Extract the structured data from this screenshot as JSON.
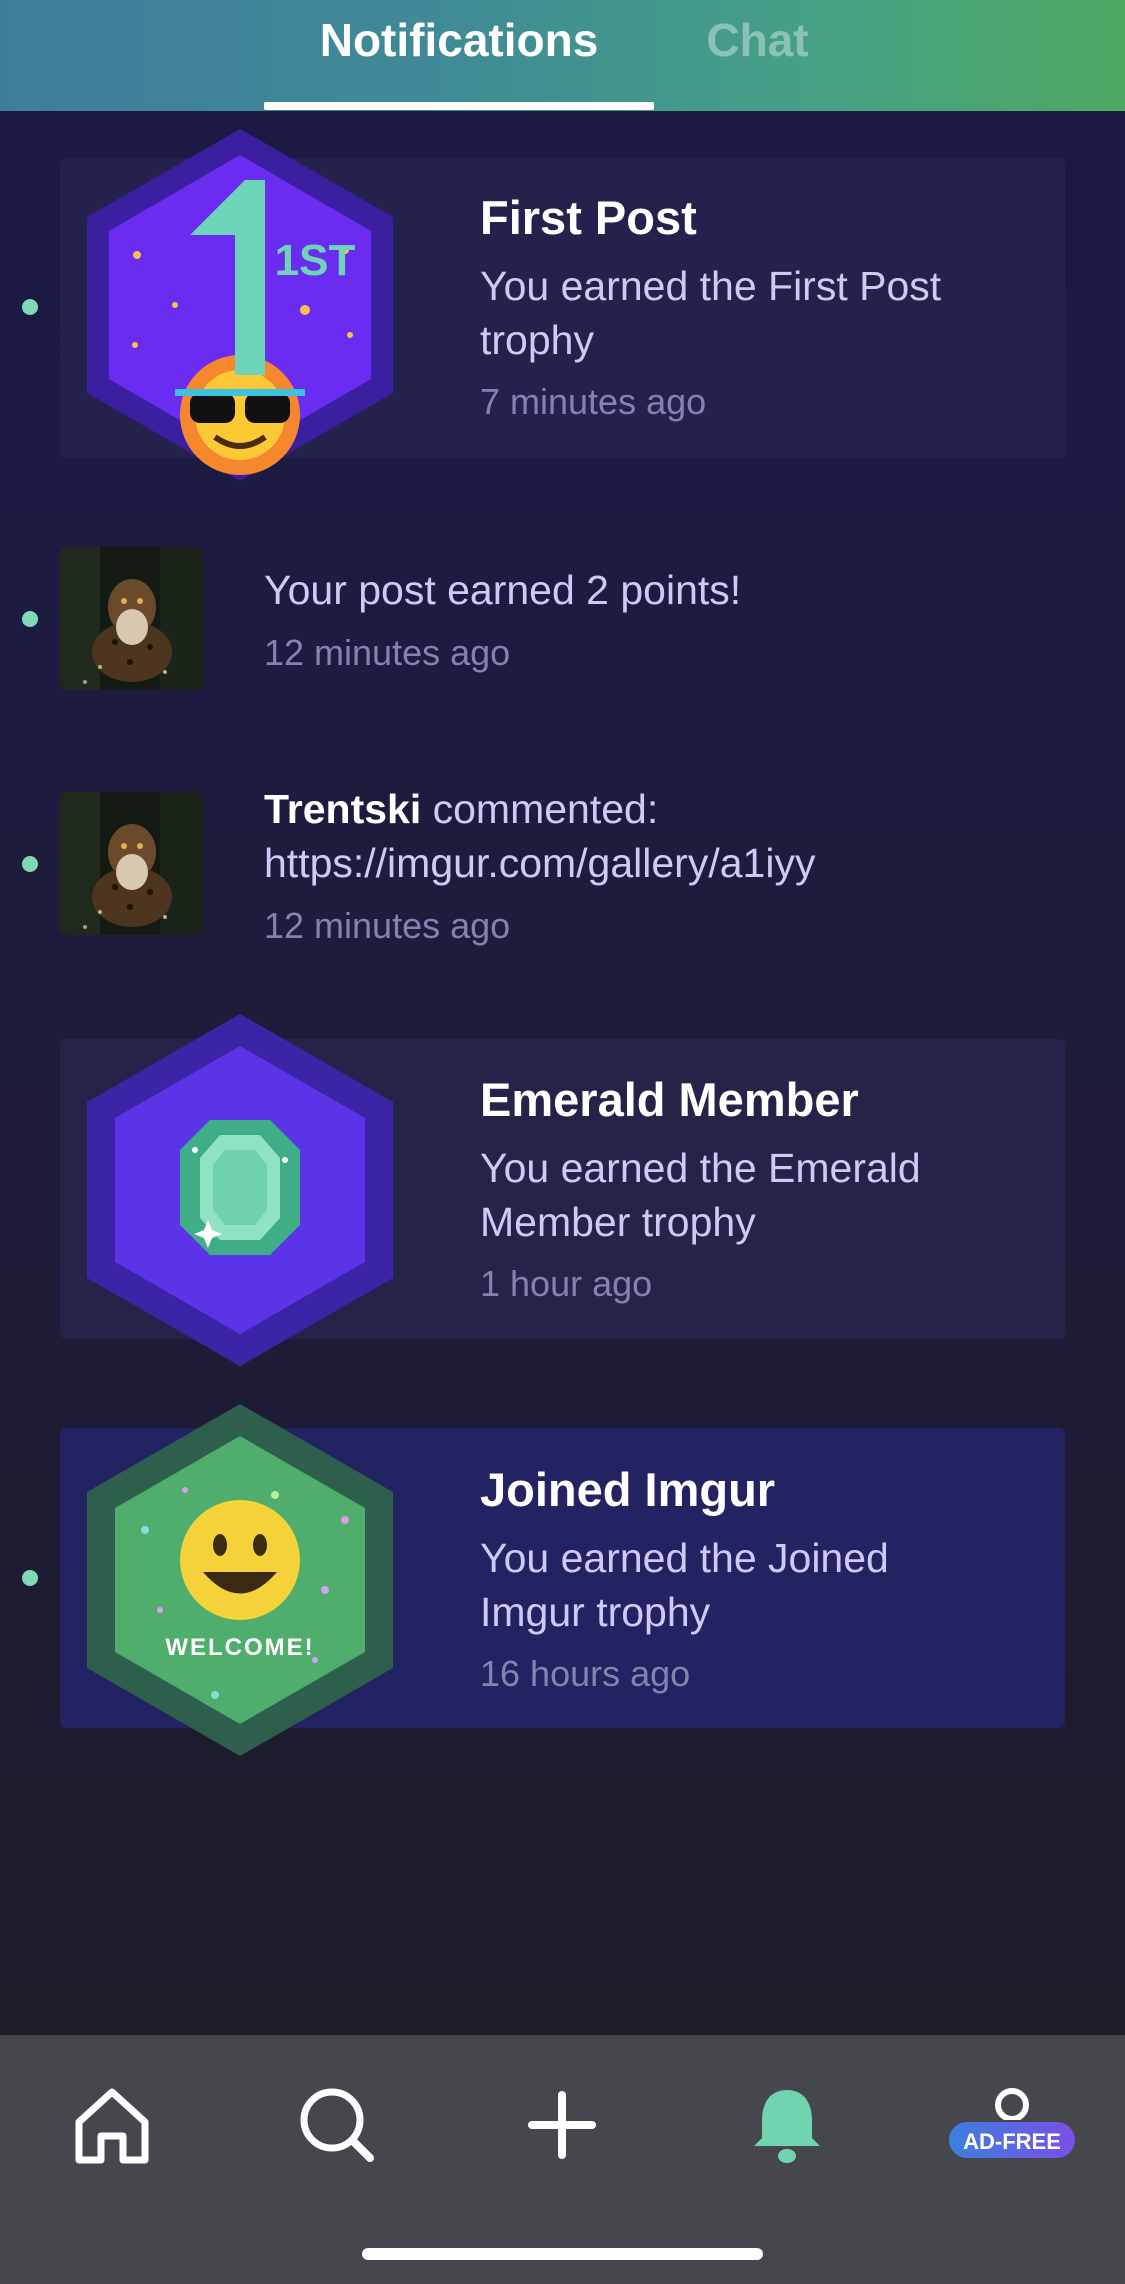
{
  "tabs": {
    "notifications": "Notifications",
    "chat": "Chat"
  },
  "notifications": [
    {
      "type": "trophy",
      "title": "First Post",
      "description": "You earned the First Post trophy",
      "time": "7 minutes ago",
      "unread": true,
      "badge": "first-post-badge",
      "badge_text": "1ST"
    },
    {
      "type": "post",
      "text": "Your post earned 2 points!",
      "time": "12 minutes ago",
      "unread": true,
      "thumbnail": "leopard-thumbnail"
    },
    {
      "type": "comment",
      "user": "Trentski",
      "text": " commented: https://imgur.com/gallery/a1iyy",
      "time": "12 minutes ago",
      "unread": true,
      "thumbnail": "leopard-thumbnail"
    },
    {
      "type": "trophy",
      "title": "Emerald Member",
      "description": "You earned the Emerald Member trophy",
      "time": "1 hour ago",
      "unread": false,
      "badge": "emerald-badge"
    },
    {
      "type": "trophy",
      "title": "Joined Imgur",
      "description": "You earned the Joined Imgur trophy",
      "time": "16 hours ago",
      "unread": true,
      "badge": "welcome-badge",
      "badge_text": "WELCOME!"
    }
  ],
  "bottom_nav": {
    "items": [
      "home-icon",
      "search-icon",
      "plus-icon",
      "bell-icon",
      "profile-icon"
    ],
    "active": "bell-icon",
    "ad_free_label": "AD-FREE"
  },
  "colors": {
    "accent": "#7ed9b4",
    "background": "#1c1a46",
    "nav_background": "#45474c"
  }
}
